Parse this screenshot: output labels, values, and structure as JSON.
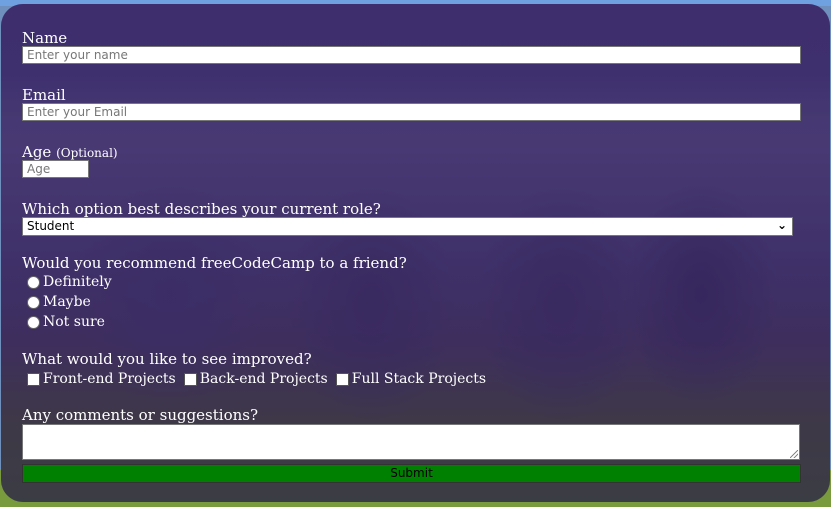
{
  "form": {
    "name": {
      "label": "Name",
      "placeholder": "Enter your name"
    },
    "email": {
      "label": "Email",
      "placeholder": "Enter your Email"
    },
    "age": {
      "label": "Age",
      "optional": "(Optional)",
      "placeholder": "Age"
    },
    "role": {
      "label": "Which option best describes your current role?",
      "selected": "Student"
    },
    "recommend": {
      "label": "Would you recommend freeCodeCamp to a friend?",
      "options": [
        "Definitely",
        "Maybe",
        "Not sure"
      ]
    },
    "improve": {
      "label": "What would you like to see improved?",
      "options": [
        "Front-end Projects",
        "Back-end Projects",
        "Full Stack Projects"
      ]
    },
    "comments": {
      "label": "Any comments or suggestions?"
    },
    "submit_label": "Submit"
  },
  "colors": {
    "overlay": "#4a3a7a",
    "submit": "#008000",
    "label_text": "#ffffff"
  }
}
